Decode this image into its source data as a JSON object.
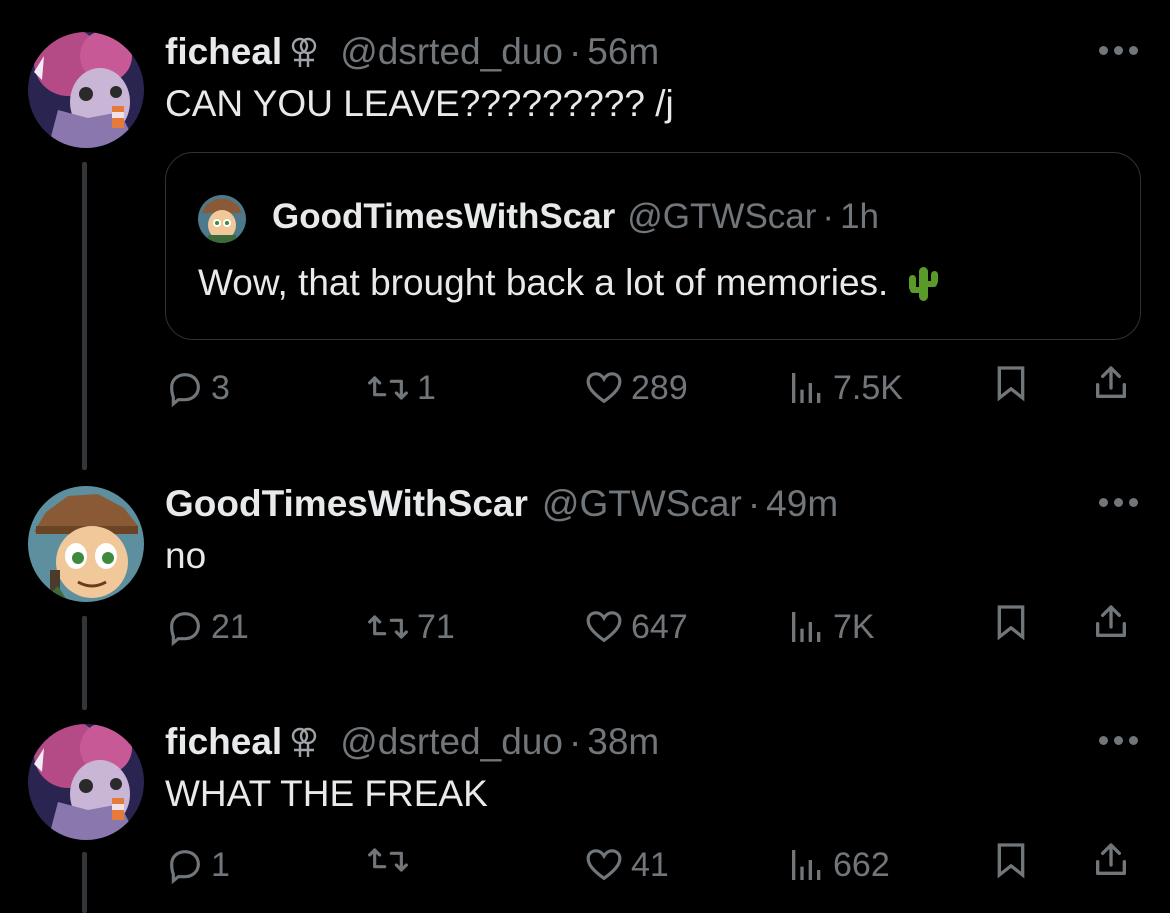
{
  "tweets": [
    {
      "name": "ficheal",
      "badge": "female-female-symbol-icon",
      "handle": "@dsrted_duo",
      "sep": "·",
      "time": "56m",
      "text": "CAN YOU LEAVE????????? /j",
      "quote": {
        "name": "GoodTimesWithScar",
        "handle": "@GTWScar",
        "sep": "·",
        "time": "1h",
        "text": "Wow, that brought back a lot of memories.",
        "emoji": "cactus-emoji"
      },
      "stats": {
        "replies": "3",
        "reposts": "1",
        "likes": "289",
        "views": "7.5K"
      }
    },
    {
      "name": "GoodTimesWithScar",
      "handle": "@GTWScar",
      "sep": "·",
      "time": "49m",
      "text": "no",
      "stats": {
        "replies": "21",
        "reposts": "71",
        "likes": "647",
        "views": "7K"
      }
    },
    {
      "name": "ficheal",
      "badge": "female-female-symbol-icon",
      "handle": "@dsrted_duo",
      "sep": "·",
      "time": "38m",
      "text": "WHAT THE FREAK",
      "stats": {
        "replies": "1",
        "reposts": "",
        "likes": "41",
        "views": "662"
      }
    }
  ],
  "colors": {
    "background": "#000000",
    "text_primary": "#e7e9ea",
    "text_secondary": "#71767b",
    "border": "#2f3336",
    "thread_line": "#333639"
  }
}
